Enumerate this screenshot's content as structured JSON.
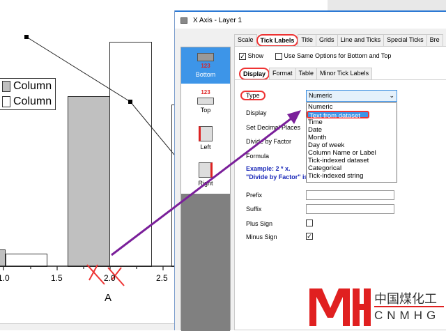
{
  "graph": {
    "legend": [
      "Column",
      "Column"
    ],
    "x_ticks": [
      "1.0",
      "1.5",
      "2.0",
      "2.5"
    ],
    "x_title": "A"
  },
  "dialog": {
    "title": "X Axis - Layer 1",
    "sidebar": [
      {
        "label": "Bottom",
        "icon": "123"
      },
      {
        "label": "Top",
        "icon": "123"
      },
      {
        "label": "Left",
        "icon": "123"
      },
      {
        "label": "Right",
        "icon": "123"
      }
    ],
    "tabs": [
      "Scale",
      "Tick Labels",
      "Title",
      "Grids",
      "Line and Ticks",
      "Special Ticks",
      "Bre"
    ],
    "show_label": "Show",
    "same_options_label": "Use Same Options for Bottom and Top",
    "subtabs": [
      "Display",
      "Format",
      "Table",
      "Minor Tick Labels"
    ],
    "rows": {
      "type": "Type",
      "display": "Display",
      "decimal": "Set Decimal Places",
      "divide": "Divide by Factor",
      "formula": "Formula",
      "prefix": "Prefix",
      "suffix": "Suffix",
      "plus": "Plus Sign",
      "minus": "Minus Sign"
    },
    "example1": "Example: 2 * x.",
    "example2": "\"Divide by Factor\" is ignored if \"Formula\" is used.",
    "type_value": "Numeric",
    "type_options": [
      "Numeric",
      "Text from dataset",
      "Time",
      "Date",
      "Month",
      "Day of week",
      "Column Name or Label",
      "Tick-indexed dataset",
      "Categorical",
      "Tick-indexed string"
    ]
  },
  "watermark": {
    "cn": "中国煤化工",
    "en": "CNMHG"
  }
}
